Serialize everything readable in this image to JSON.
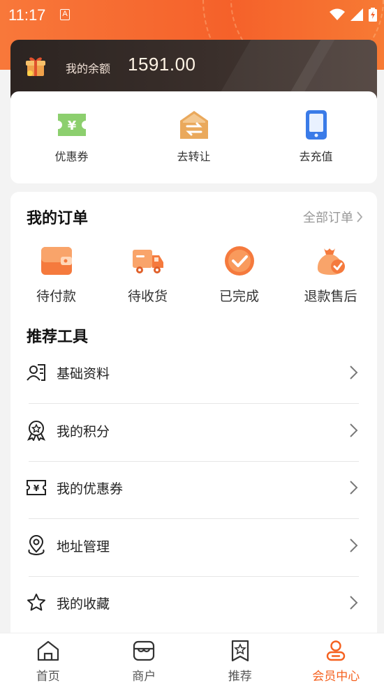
{
  "status_bar": {
    "time": "11:17",
    "notif_letter": "A"
  },
  "balance": {
    "label": "我的余额",
    "value": "1591.00"
  },
  "quick_actions": [
    {
      "label": "优惠券",
      "icon": "coupon-icon"
    },
    {
      "label": "去转让",
      "icon": "transfer-house-icon"
    },
    {
      "label": "去充值",
      "icon": "phone-recharge-icon"
    }
  ],
  "orders": {
    "title": "我的订单",
    "all_label": "全部订单",
    "items": [
      {
        "label": "待付款",
        "icon": "wallet-icon"
      },
      {
        "label": "待收货",
        "icon": "truck-icon"
      },
      {
        "label": "已完成",
        "icon": "check-circle-icon"
      },
      {
        "label": "退款售后",
        "icon": "refund-bag-icon"
      }
    ]
  },
  "tools": {
    "title": "推荐工具",
    "items": [
      {
        "label": "基础资料",
        "icon": "profile-card-icon"
      },
      {
        "label": "我的积分",
        "icon": "medal-icon"
      },
      {
        "label": "我的优惠券",
        "icon": "ticket-icon"
      },
      {
        "label": "地址管理",
        "icon": "location-pin-icon"
      },
      {
        "label": "我的收藏",
        "icon": "star-icon"
      }
    ]
  },
  "tabbar": {
    "items": [
      {
        "label": "首页",
        "icon": "home-icon"
      },
      {
        "label": "商户",
        "icon": "store-icon"
      },
      {
        "label": "推荐",
        "icon": "recommend-icon"
      },
      {
        "label": "会员中心",
        "icon": "member-icon",
        "active": true
      }
    ]
  },
  "colors": {
    "accent": "#f5611f",
    "header": "#f5612a",
    "balance_bg": "#2c2421"
  }
}
